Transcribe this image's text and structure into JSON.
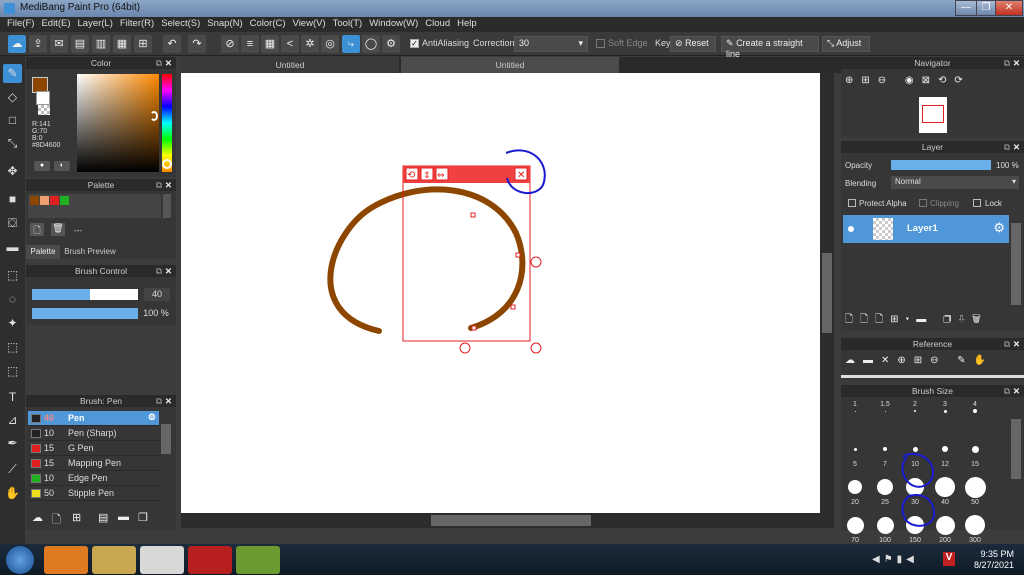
{
  "window": {
    "title": "MediBang Paint Pro (64bit)"
  },
  "menu": [
    "File(F)",
    "Edit(E)",
    "Layer(L)",
    "Filter(R)",
    "Select(S)",
    "Snap(N)",
    "Color(C)",
    "View(V)",
    "Tool(T)",
    "Window(W)",
    "Cloud",
    "Help"
  ],
  "toolbar": {
    "antialiasing": "AntiAliasing",
    "correction_label": "Correction",
    "correction_value": "30",
    "soft_edge": "Soft Edge",
    "key": "Key",
    "reset": "Reset",
    "straight_line": "Create a straight line",
    "adjust": "Adjust"
  },
  "tabs": [
    "Untitled",
    "Untitled"
  ],
  "color_panel": {
    "title": "Color",
    "r": "R:141",
    "g": "G:70",
    "b": "B:0",
    "hex": "#8D4600",
    "fg": "#8d4600"
  },
  "palette_panel": {
    "title": "Palette",
    "swatches": [
      "#8d4600",
      "#f0a070",
      "#e02020",
      "#20b020"
    ],
    "dash": "---",
    "tab_palette": "Palette",
    "tab_preview": "Brush Preview"
  },
  "brush_control": {
    "title": "Brush Control",
    "size": "40",
    "opacity": "100 %",
    "size_fill": 0.55,
    "opacity_fill": 1.0
  },
  "brush_list": {
    "title": "Brush: Pen",
    "items": [
      {
        "size": "40",
        "name": "Pen",
        "color": "#222222"
      },
      {
        "size": "10",
        "name": "Pen (Sharp)",
        "color": "#222222"
      },
      {
        "size": "15",
        "name": "G Pen",
        "color": "#e02020"
      },
      {
        "size": "15",
        "name": "Mapping Pen",
        "color": "#e02020"
      },
      {
        "size": "10",
        "name": "Edge Pen",
        "color": "#20b020"
      },
      {
        "size": "50",
        "name": "Stipple Pen",
        "color": "#f0e020"
      }
    ]
  },
  "navigator": {
    "title": "Navigator"
  },
  "layer_panel": {
    "title": "Layer",
    "opacity_label": "Opacity",
    "opacity_value": "100 %",
    "blending_label": "Blending",
    "blending_value": "Normal",
    "protect_alpha": "Protect Alpha",
    "clipping": "Clipping",
    "lock": "Lock",
    "layer_name": "Layer1"
  },
  "reference": {
    "title": "Reference"
  },
  "brush_size": {
    "title": "Brush Size",
    "rows": [
      [
        "1",
        "1.5",
        "2",
        "3",
        "4"
      ],
      [
        "5",
        "7",
        "10",
        "12",
        "15"
      ],
      [
        "20",
        "25",
        "30",
        "40",
        "50"
      ],
      [
        "70",
        "100",
        "150",
        "200",
        "300"
      ]
    ]
  },
  "taskbar": {
    "time": "9:35 PM",
    "date": "8/27/2021"
  }
}
